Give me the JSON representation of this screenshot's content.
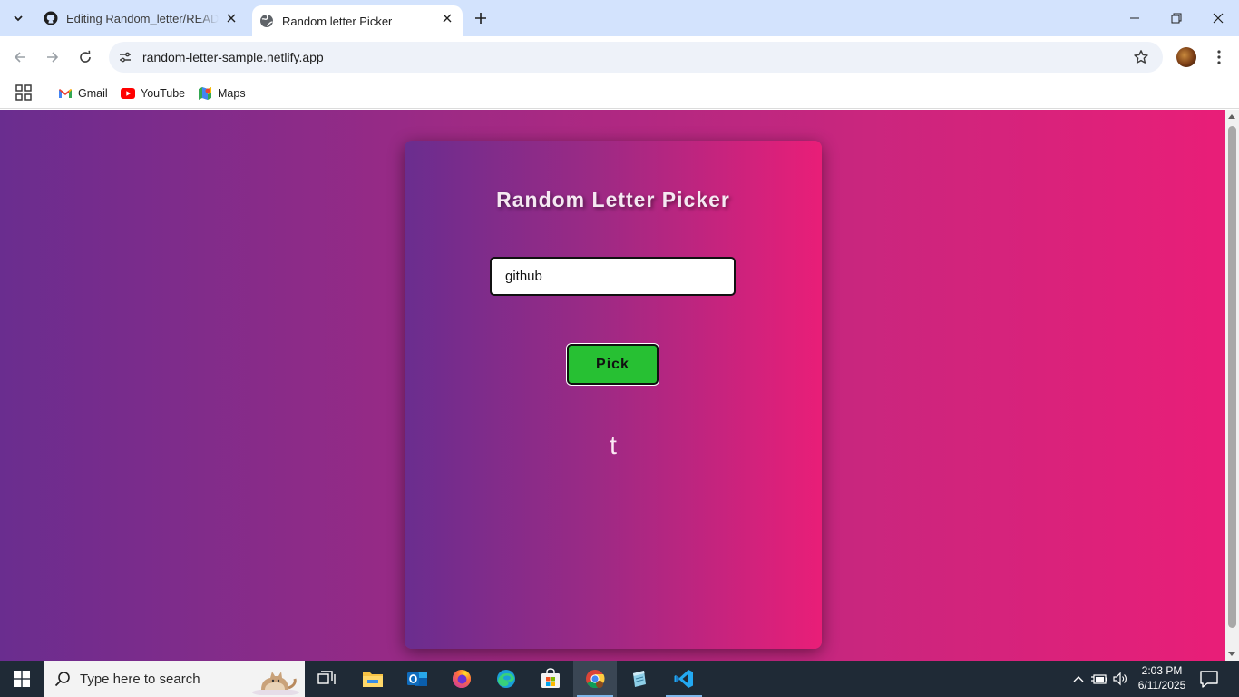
{
  "browser": {
    "tabs": [
      {
        "title": "Editing Random_letter/README",
        "favicon": "github-icon",
        "active": false
      },
      {
        "title": "Random letter Picker",
        "favicon": "globe-icon",
        "active": true
      }
    ],
    "url": "random-letter-sample.netlify.app",
    "bookmarks": [
      {
        "label": "Gmail",
        "icon": "gmail-icon"
      },
      {
        "label": "YouTube",
        "icon": "youtube-icon"
      },
      {
        "label": "Maps",
        "icon": "maps-icon"
      }
    ]
  },
  "page": {
    "title": "Random Letter Picker",
    "input_value": "github",
    "button_label": "Pick",
    "result": "t",
    "colors": {
      "gradient_start": "#6a2d8f",
      "gradient_end": "#e91e78",
      "button": "#27c033"
    }
  },
  "taskbar": {
    "search_placeholder": "Type here to search",
    "time": "2:03 PM",
    "date": "6/11/2025",
    "apps": [
      "task-view-icon",
      "file-explorer-icon",
      "outlook-icon",
      "firefox-icon",
      "edge-icon",
      "microsoft-store-icon",
      "chrome-icon",
      "notepad-icon",
      "vscode-icon"
    ]
  }
}
